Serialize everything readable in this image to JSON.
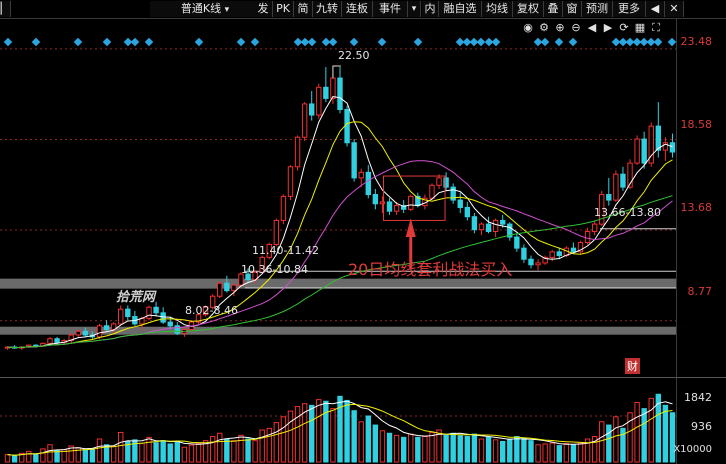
{
  "toolbar": {
    "stock_name": "普通K线",
    "items": [
      "发",
      "PK",
      "简",
      "九转",
      "连板",
      "事件",
      "内",
      "融自选",
      "均线",
      "复权",
      "叠",
      "窗",
      "预测",
      "更多"
    ]
  },
  "price_axis": [
    "23.48",
    "18.58",
    "13.68",
    "8.77"
  ],
  "volume_axis": [
    "1842",
    "936",
    "X10000"
  ],
  "watermark": "拾荒网",
  "annotations": {
    "peak": "22.50",
    "range1": "11.40-11.42",
    "range2": "10.36-10.84",
    "range3": "8.02-8.46",
    "range4": "13.66-13.80",
    "strategy": "20日均线套利战法买入",
    "marker": "财"
  },
  "colors": {
    "up": "#f03030",
    "down": "#30d0e0",
    "ma1": "#ffffff",
    "ma2": "#f0f000",
    "ma3": "#d050d0",
    "ma4": "#30c030",
    "accent": "#d83a3a"
  },
  "chart_data": {
    "type": "candlestick",
    "y_range": [
      6.0,
      24.5
    ],
    "candles": [
      [
        7.3,
        7.4,
        7.2,
        7.35
      ],
      [
        7.35,
        7.45,
        7.25,
        7.3
      ],
      [
        7.3,
        7.4,
        7.2,
        7.35
      ],
      [
        7.35,
        7.5,
        7.3,
        7.45
      ],
      [
        7.45,
        7.5,
        7.35,
        7.4
      ],
      [
        7.4,
        7.6,
        7.35,
        7.55
      ],
      [
        7.55,
        7.9,
        7.5,
        7.8
      ],
      [
        7.8,
        7.9,
        7.5,
        7.6
      ],
      [
        7.6,
        7.8,
        7.5,
        7.7
      ],
      [
        7.7,
        8.1,
        7.6,
        8.0
      ],
      [
        8.0,
        8.3,
        7.9,
        8.2
      ],
      [
        8.2,
        8.4,
        7.9,
        8.0
      ],
      [
        8.0,
        8.2,
        7.8,
        7.9
      ],
      [
        7.9,
        8.6,
        7.8,
        8.5
      ],
      [
        8.5,
        8.8,
        8.2,
        8.3
      ],
      [
        8.3,
        8.7,
        8.1,
        8.6
      ],
      [
        8.6,
        9.6,
        8.5,
        9.4
      ],
      [
        9.4,
        9.6,
        8.8,
        9.0
      ],
      [
        9.0,
        9.3,
        8.5,
        8.6
      ],
      [
        8.6,
        9.0,
        8.3,
        8.9
      ],
      [
        8.9,
        9.6,
        8.8,
        9.5
      ],
      [
        9.5,
        9.8,
        9.0,
        9.2
      ],
      [
        9.2,
        9.5,
        8.6,
        8.7
      ],
      [
        8.7,
        9.0,
        8.3,
        8.5
      ],
      [
        8.5,
        8.7,
        8.0,
        8.1
      ],
      [
        8.1,
        8.4,
        7.9,
        8.3
      ],
      [
        8.3,
        8.8,
        8.2,
        8.7
      ],
      [
        8.7,
        9.2,
        8.6,
        9.1
      ],
      [
        9.1,
        9.6,
        9.0,
        9.5
      ],
      [
        9.5,
        10.2,
        9.4,
        10.1
      ],
      [
        10.1,
        10.9,
        10.0,
        10.8
      ],
      [
        10.8,
        11.2,
        10.3,
        10.4
      ],
      [
        10.4,
        10.8,
        10.1,
        10.7
      ],
      [
        10.7,
        11.4,
        10.6,
        11.3
      ],
      [
        11.3,
        11.6,
        10.9,
        11.0
      ],
      [
        11.0,
        11.5,
        10.8,
        11.4
      ],
      [
        11.4,
        12.3,
        11.3,
        12.2
      ],
      [
        12.2,
        13.0,
        12.1,
        12.9
      ],
      [
        12.9,
        14.3,
        12.8,
        14.2
      ],
      [
        14.2,
        15.6,
        14.0,
        15.5
      ],
      [
        15.5,
        17.2,
        15.3,
        17.1
      ],
      [
        17.1,
        18.8,
        16.9,
        18.7
      ],
      [
        18.7,
        20.6,
        18.5,
        20.5
      ],
      [
        20.5,
        21.2,
        19.6,
        19.9
      ],
      [
        19.9,
        21.6,
        19.7,
        21.4
      ],
      [
        21.4,
        22.5,
        20.6,
        20.8
      ],
      [
        20.8,
        22.1,
        20.5,
        21.9
      ],
      [
        21.9,
        22.5,
        20.0,
        20.2
      ],
      [
        20.2,
        20.4,
        18.2,
        18.4
      ],
      [
        18.4,
        18.6,
        16.3,
        16.5
      ],
      [
        16.5,
        17.0,
        16.0,
        16.8
      ],
      [
        16.8,
        17.2,
        15.4,
        15.6
      ],
      [
        15.6,
        15.9,
        14.8,
        15.1
      ],
      [
        15.1,
        15.5,
        14.6,
        15.2
      ],
      [
        15.2,
        15.4,
        14.5,
        14.7
      ],
      [
        14.7,
        15.2,
        14.5,
        15.0
      ],
      [
        15.0,
        15.3,
        14.6,
        14.8
      ],
      [
        14.8,
        15.6,
        14.7,
        15.5
      ],
      [
        15.5,
        15.7,
        14.9,
        15.0
      ],
      [
        15.0,
        15.6,
        14.8,
        15.4
      ],
      [
        15.4,
        16.2,
        15.3,
        16.1
      ],
      [
        16.1,
        16.7,
        15.9,
        16.5
      ],
      [
        16.5,
        16.8,
        15.8,
        16.0
      ],
      [
        16.0,
        16.2,
        15.1,
        15.3
      ],
      [
        15.3,
        15.7,
        14.6,
        14.9
      ],
      [
        14.9,
        15.2,
        14.2,
        14.4
      ],
      [
        14.4,
        14.6,
        13.5,
        13.7
      ],
      [
        13.7,
        14.1,
        13.4,
        14.0
      ],
      [
        14.0,
        14.4,
        13.5,
        13.6
      ],
      [
        13.6,
        14.3,
        13.3,
        14.2
      ],
      [
        14.2,
        14.5,
        13.8,
        14.0
      ],
      [
        14.0,
        14.1,
        13.1,
        13.3
      ],
      [
        13.3,
        13.5,
        12.5,
        12.7
      ],
      [
        12.7,
        12.9,
        11.9,
        12.1
      ],
      [
        12.1,
        12.3,
        11.6,
        11.8
      ],
      [
        11.8,
        12.1,
        11.5,
        11.9
      ],
      [
        11.9,
        12.3,
        11.8,
        12.2
      ],
      [
        12.2,
        12.6,
        12.0,
        12.5
      ],
      [
        12.5,
        12.7,
        12.1,
        12.3
      ],
      [
        12.3,
        12.8,
        12.2,
        12.7
      ],
      [
        12.7,
        13.0,
        12.4,
        12.5
      ],
      [
        12.5,
        13.1,
        12.4,
        13.0
      ],
      [
        13.0,
        13.8,
        12.9,
        13.6
      ],
      [
        13.6,
        14.2,
        13.4,
        14.0
      ],
      [
        14.0,
        15.8,
        13.9,
        15.6
      ],
      [
        15.6,
        16.5,
        15.0,
        15.3
      ],
      [
        15.3,
        16.9,
        15.2,
        16.7
      ],
      [
        16.7,
        17.1,
        15.8,
        16.0
      ],
      [
        16.0,
        17.5,
        15.9,
        17.3
      ],
      [
        17.3,
        18.8,
        17.2,
        18.6
      ],
      [
        18.6,
        19.0,
        17.0,
        17.3
      ],
      [
        17.3,
        19.5,
        17.1,
        19.3
      ],
      [
        19.3,
        20.6,
        17.6,
        18.0
      ],
      [
        18.0,
        18.7,
        17.4,
        18.4
      ],
      [
        18.4,
        18.9,
        17.6,
        17.9
      ]
    ],
    "ma_lines": [
      "ma5",
      "ma10",
      "ma20",
      "ma60"
    ],
    "volume": [
      [
        180,
        0
      ],
      [
        150,
        1
      ],
      [
        210,
        0
      ],
      [
        260,
        0
      ],
      [
        190,
        1
      ],
      [
        320,
        0
      ],
      [
        420,
        0
      ],
      [
        280,
        1
      ],
      [
        300,
        0
      ],
      [
        390,
        0
      ],
      [
        350,
        0
      ],
      [
        300,
        1
      ],
      [
        320,
        1
      ],
      [
        560,
        0
      ],
      [
        420,
        1
      ],
      [
        380,
        0
      ],
      [
        720,
        0
      ],
      [
        500,
        1
      ],
      [
        540,
        1
      ],
      [
        460,
        0
      ],
      [
        600,
        0
      ],
      [
        470,
        1
      ],
      [
        520,
        1
      ],
      [
        440,
        1
      ],
      [
        480,
        1
      ],
      [
        360,
        0
      ],
      [
        410,
        0
      ],
      [
        450,
        0
      ],
      [
        520,
        0
      ],
      [
        620,
        0
      ],
      [
        700,
        0
      ],
      [
        560,
        1
      ],
      [
        520,
        0
      ],
      [
        650,
        0
      ],
      [
        560,
        1
      ],
      [
        520,
        0
      ],
      [
        780,
        0
      ],
      [
        820,
        0
      ],
      [
        960,
        0
      ],
      [
        1100,
        0
      ],
      [
        1240,
        0
      ],
      [
        1350,
        0
      ],
      [
        1420,
        0
      ],
      [
        1380,
        1
      ],
      [
        1520,
        0
      ],
      [
        1480,
        1
      ],
      [
        1300,
        0
      ],
      [
        1600,
        1
      ],
      [
        1500,
        1
      ],
      [
        1250,
        1
      ],
      [
        980,
        0
      ],
      [
        1120,
        1
      ],
      [
        900,
        1
      ],
      [
        760,
        0
      ],
      [
        700,
        1
      ],
      [
        650,
        0
      ],
      [
        600,
        1
      ],
      [
        680,
        0
      ],
      [
        600,
        1
      ],
      [
        620,
        0
      ],
      [
        720,
        0
      ],
      [
        780,
        0
      ],
      [
        650,
        1
      ],
      [
        700,
        1
      ],
      [
        640,
        1
      ],
      [
        620,
        1
      ],
      [
        680,
        1
      ],
      [
        560,
        0
      ],
      [
        600,
        1
      ],
      [
        540,
        0
      ],
      [
        500,
        1
      ],
      [
        560,
        1
      ],
      [
        620,
        1
      ],
      [
        580,
        1
      ],
      [
        520,
        1
      ],
      [
        420,
        0
      ],
      [
        440,
        0
      ],
      [
        460,
        0
      ],
      [
        400,
        1
      ],
      [
        450,
        0
      ],
      [
        420,
        1
      ],
      [
        460,
        0
      ],
      [
        560,
        0
      ],
      [
        620,
        0
      ],
      [
        980,
        0
      ],
      [
        900,
        1
      ],
      [
        1100,
        0
      ],
      [
        820,
        1
      ],
      [
        1200,
        0
      ],
      [
        1450,
        0
      ],
      [
        1300,
        1
      ],
      [
        1550,
        0
      ],
      [
        1650,
        1
      ],
      [
        1380,
        1
      ],
      [
        1200,
        1
      ]
    ]
  }
}
